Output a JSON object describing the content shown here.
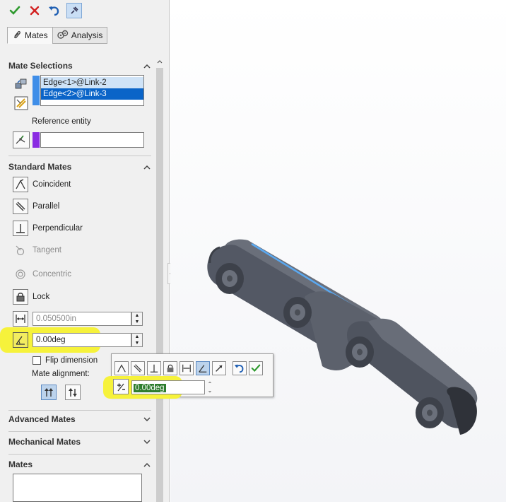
{
  "toolbar": {
    "ok_icon": "check-icon",
    "cancel_icon": "x-icon",
    "undo_icon": "undo-icon",
    "pin_icon": "pin-icon"
  },
  "tabs": [
    {
      "label": "Mates",
      "icon": "paperclip-icon",
      "active": true
    },
    {
      "label": "Analysis",
      "icon": "gears-icon",
      "active": false
    }
  ],
  "mate_selections": {
    "title": "Mate Selections",
    "items": [
      "Edge<1>@Link-2",
      "Edge<2>@Link-3"
    ],
    "reference_label": "Reference entity"
  },
  "standard_mates": {
    "title": "Standard Mates",
    "items": [
      {
        "label": "Coincident",
        "enabled": true
      },
      {
        "label": "Parallel",
        "enabled": true
      },
      {
        "label": "Perpendicular",
        "enabled": true
      },
      {
        "label": "Tangent",
        "enabled": false
      },
      {
        "label": "Concentric",
        "enabled": false
      },
      {
        "label": "Lock",
        "enabled": true
      }
    ],
    "distance_value": "0.050500in",
    "angle_value": "0.00deg",
    "flip_label": "Flip dimension",
    "alignment_label": "Mate alignment:"
  },
  "sections": {
    "advanced": "Advanced Mates",
    "mechanical": "Mechanical Mates",
    "mates": "Mates"
  },
  "popup": {
    "angle_value": "0.00deg"
  },
  "colors": {
    "accent_blue": "#0a64c8",
    "highlight_yellow": "#f6f23b",
    "ok_green": "#2e9a2e",
    "cancel_red": "#d22020",
    "entity_purple": "#8a2be2"
  }
}
